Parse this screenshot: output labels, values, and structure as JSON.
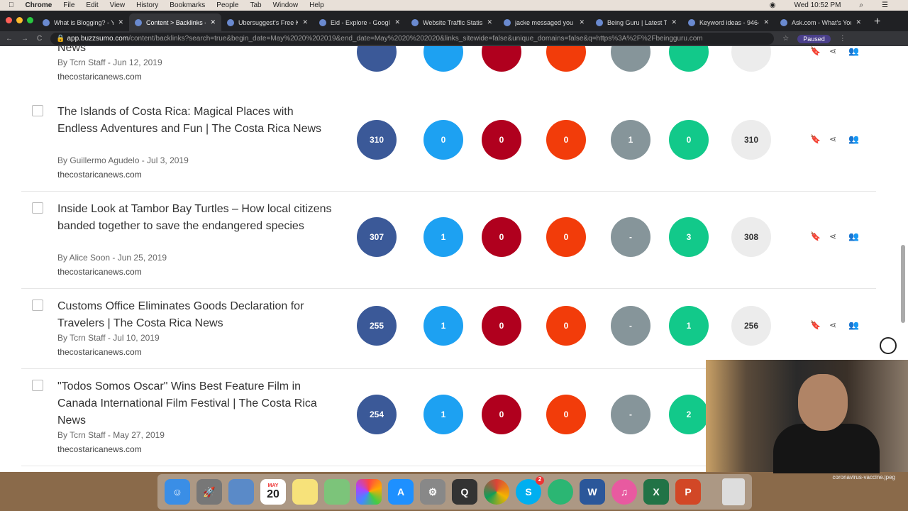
{
  "menubar": {
    "items": [
      "Chrome",
      "File",
      "Edit",
      "View",
      "History",
      "Bookmarks",
      "People",
      "Tab",
      "Window",
      "Help"
    ],
    "clock": "Wed 10:52 PM"
  },
  "tabs": [
    {
      "label": "What is Blogging? - Yo"
    },
    {
      "label": "Content > Backlinks - B",
      "active": true
    },
    {
      "label": "Ubersuggest's Free Ke"
    },
    {
      "label": "Eid - Explore - Google"
    },
    {
      "label": "Website Traffic Statist"
    },
    {
      "label": "jacke messaged you"
    },
    {
      "label": "Being Guru | Latest Te"
    },
    {
      "label": "Keyword ideas - 946-"
    },
    {
      "label": "Ask.com - What's Your"
    }
  ],
  "address": {
    "domain": "app.buzzsumo.com",
    "path": "/content/backlinks?search=true&begin_date=May%2020%202019&end_date=May%2020%202020&links_sitewide=false&unique_domains=false&q=https%3A%2F%2Fbeingguru.com",
    "profile": "Paused"
  },
  "colors": {
    "facebook": "#3b5998",
    "twitter": "#1da1f2",
    "pinterest": "#b0001e",
    "reddit": "#f23c0a",
    "gray": "#86959a",
    "green": "#12c98a",
    "total": "#ececec"
  },
  "rows": [
    {
      "title": "News",
      "by": "By Tcrn Staff - Jun 12, 2019",
      "domain": "thecostaricanews.com",
      "values": [
        "",
        "",
        "",
        "",
        "",
        "",
        ""
      ]
    },
    {
      "title": "The Islands of Costa Rica: Magical Places with Endless Adventures and Fun | The Costa Rica News",
      "by": "By Guillermo Agudelo - Jul 3, 2019",
      "domain": "thecostaricanews.com",
      "values": [
        "310",
        "0",
        "0",
        "0",
        "1",
        "0",
        "310"
      ]
    },
    {
      "title": "Inside Look at Tambor Bay Turtles – How local citizens banded together to save the endangered species",
      "by": "By Alice Soon - Jun 25, 2019",
      "domain": "thecostaricanews.com",
      "values": [
        "307",
        "1",
        "0",
        "0",
        "-",
        "3",
        "308"
      ]
    },
    {
      "title": "Customs Office Eliminates Goods Declaration for Travelers | The Costa Rica News",
      "by": "By Tcrn Staff - Jul 10, 2019",
      "domain": "thecostaricanews.com",
      "values": [
        "255",
        "1",
        "0",
        "0",
        "-",
        "1",
        "256"
      ]
    },
    {
      "title": "\"Todos Somos Oscar\" Wins Best Feature Film in Canada International Film Festival | The Costa Rica News",
      "by": "By Tcrn Staff - May 27, 2019",
      "domain": "thecostaricanews.com",
      "values": [
        "254",
        "1",
        "0",
        "0",
        "-",
        "2",
        ""
      ]
    }
  ],
  "dock": {
    "calendar_month": "MAY",
    "calendar_day": "20",
    "badge": "2"
  },
  "desktop_file": "coronavirus-vaccine.jpeg"
}
